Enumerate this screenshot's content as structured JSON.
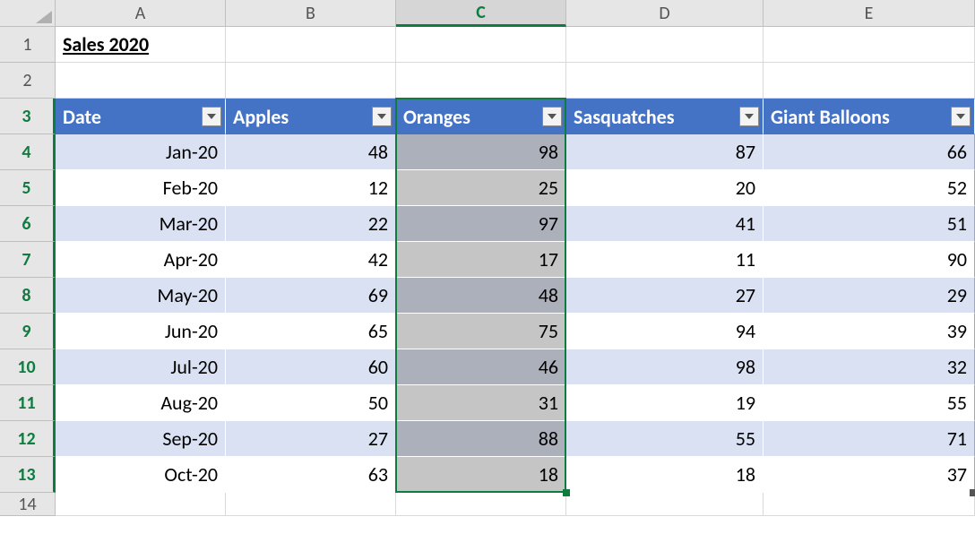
{
  "columns": [
    "A",
    "B",
    "C",
    "D",
    "E"
  ],
  "row_numbers": [
    "1",
    "2",
    "3",
    "4",
    "5",
    "6",
    "7",
    "8",
    "9",
    "10",
    "11",
    "12",
    "13",
    "14"
  ],
  "title": "Sales 2020",
  "selected_column": "C",
  "table": {
    "headers": [
      "Date",
      "Apples",
      "Oranges",
      "Sasquatches",
      "Giant Balloons"
    ],
    "rows": [
      {
        "date": "Jan-20",
        "apples": "48",
        "oranges": "98",
        "sasquatches": "87",
        "balloons": "66"
      },
      {
        "date": "Feb-20",
        "apples": "12",
        "oranges": "25",
        "sasquatches": "20",
        "balloons": "52"
      },
      {
        "date": "Mar-20",
        "apples": "22",
        "oranges": "97",
        "sasquatches": "41",
        "balloons": "51"
      },
      {
        "date": "Apr-20",
        "apples": "42",
        "oranges": "17",
        "sasquatches": "11",
        "balloons": "90"
      },
      {
        "date": "May-20",
        "apples": "69",
        "oranges": "48",
        "sasquatches": "27",
        "balloons": "29"
      },
      {
        "date": "Jun-20",
        "apples": "65",
        "oranges": "75",
        "sasquatches": "94",
        "balloons": "39"
      },
      {
        "date": "Jul-20",
        "apples": "60",
        "oranges": "46",
        "sasquatches": "98",
        "balloons": "32"
      },
      {
        "date": "Aug-20",
        "apples": "50",
        "oranges": "31",
        "sasquatches": "19",
        "balloons": "55"
      },
      {
        "date": "Sep-20",
        "apples": "27",
        "oranges": "88",
        "sasquatches": "55",
        "balloons": "71"
      },
      {
        "date": "Oct-20",
        "apples": "63",
        "oranges": "18",
        "sasquatches": "18",
        "balloons": "37"
      }
    ]
  }
}
